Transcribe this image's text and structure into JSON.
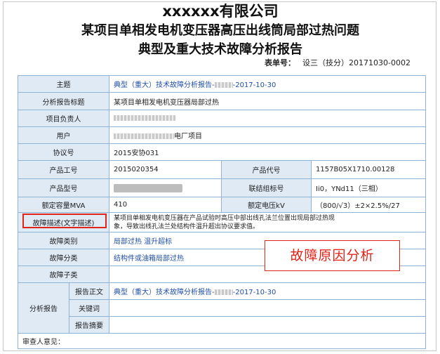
{
  "header": {
    "company": "xxxxxx有限公司",
    "title_line1": "某项目单相发电机变压器高压出线筒局部过热问题",
    "title_line2": "典型及重大技术故障分析报告",
    "form_no_label": "表单号：",
    "form_no_value": "设三（技分）20171030-0002"
  },
  "rows": {
    "subject_label": "主题",
    "subject_prefix": "典型（重大）技术故障分析报告-",
    "subject_suffix": "-2017-10-30",
    "analysis_title_label": "分析报告标题",
    "analysis_title_value": "某项目单相发电机变压器局部过热",
    "manager_label": "项目负责人",
    "user_label": "用户",
    "user_suffix": "电厂项目",
    "agreement_label": "协议号",
    "agreement_value": "2015安协031",
    "product_code_label": "产品工号",
    "product_code_value": "2015020354",
    "product_no_label": "产品代号",
    "product_no_value": "1157B05X1710.00128",
    "model_label": "产品型号",
    "vector_label": "联结组标号",
    "vector_value": "Ii0，YNd11（三相）",
    "capacity_label": "额定容量MVA",
    "capacity_value": "410",
    "voltage_label": "额定电压kV",
    "voltage_value": "（800/√3）±2×2.5%/27",
    "fault_desc_label": "故障描述(文字描述)",
    "fault_desc_line1": "某项目单相发电机变压器在产品试验时高压中部出线孔法兰位置出现局部过热现",
    "fault_desc_line2": "象，导致出线孔法兰处结构件温升超出协议要求值。",
    "fault_category_label": "故障类别",
    "fault_category_value": "局部过热 温升超标",
    "fault_class_label": "故障分类",
    "fault_class_value": "结构件或油箱局部过热",
    "fault_sub_label": "故障子类",
    "analysis_report_label": "分析报告",
    "report_body_label": "报告正文",
    "report_body_prefix": "典型（重大）技术故障分析报告-",
    "report_body_suffix": "-2017-10-30",
    "keywords_label": "关键词",
    "summary_label": "报告摘要",
    "reviewer_label": "审查人意见："
  },
  "callout": {
    "text": "故障原因分析"
  },
  "colors": {
    "label_bg": "#dfeaf5",
    "border": "#8fb3d4",
    "highlight_red": "#e2231a",
    "link_blue": "#1f4fa8"
  }
}
